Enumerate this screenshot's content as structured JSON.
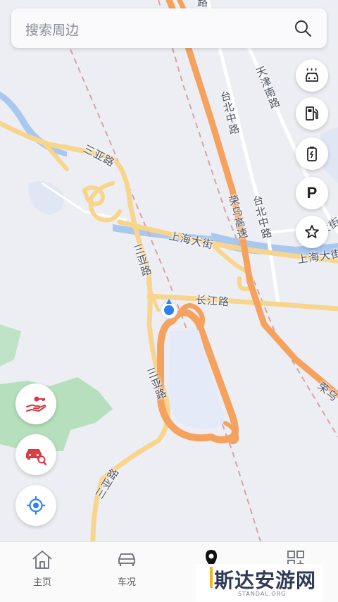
{
  "search": {
    "placeholder": "搜索周边"
  },
  "map": {
    "labels": {
      "sanya_road_1": "三亚路",
      "sanya_road_2": "三亚路",
      "sanya_road_3": "三亚路",
      "sanya_road_4": "三亚路",
      "shanghai_st_1": "上海大街",
      "shanghai_st_2": "上海大街",
      "shanghai_st_3": "大街",
      "changjiang_road": "长江路",
      "taibei_middle_1": "台北中路",
      "taibei_middle_2": "台北中路",
      "tianjin_south": "天津南路",
      "rongwu_exp_1": "荣乌高速",
      "rongwu_exp_2": "荣乌",
      "top_fragment": "路"
    }
  },
  "side_buttons": {
    "parking_label": "P"
  },
  "tabbar": {
    "tabs": [
      {
        "label": "主页",
        "icon": "home-icon"
      },
      {
        "label": "车况",
        "icon": "car-status-icon"
      },
      {
        "label": "",
        "icon": "map-pin-icon"
      },
      {
        "label": "",
        "icon": "apps-grid-icon"
      }
    ]
  },
  "watermark": {
    "text": "斯达安游网",
    "sub": "STANDAL.ORG"
  },
  "colors": {
    "accent": "#2d7ff9",
    "red_icon": "#d9363e",
    "highway": "#f5a25e",
    "road": "#f7d58c"
  }
}
